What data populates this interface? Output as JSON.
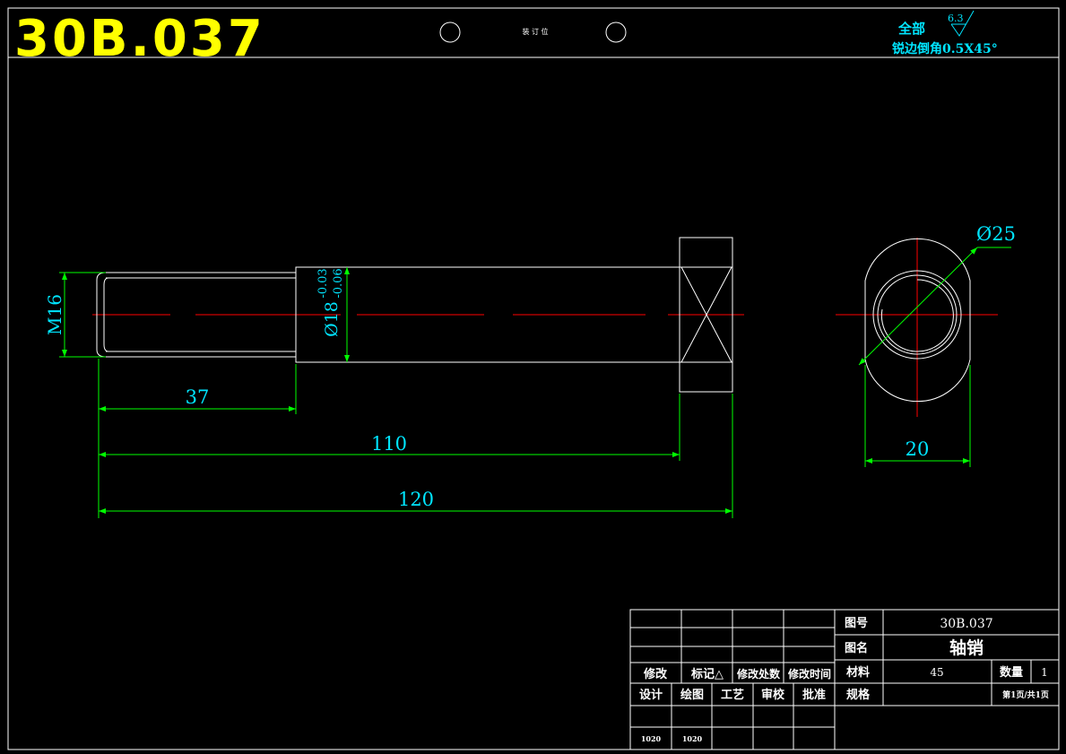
{
  "header": {
    "drawing_code": "30B.037",
    "binding_label": "装 订 位"
  },
  "surface_note": {
    "all_label": "全部",
    "roughness_value": "6.3",
    "chamfer_note": "锐边倒角0.5X45°"
  },
  "dimensions": {
    "thread": "M16",
    "diameter_main": "Ø18",
    "tol_upper": "-0.03",
    "tol_lower": "-0.06",
    "len_thread": "37",
    "len_shank": "110",
    "len_total": "120",
    "diameter_head": "Ø25",
    "width_flats": "20"
  },
  "title_block": {
    "drawing_no_label": "图号",
    "drawing_no_value": "30B.037",
    "name_label": "图名",
    "name_value": "轴销",
    "material_label": "材料",
    "material_value": "45",
    "qty_label": "数量",
    "qty_value": "1",
    "spec_label": "规格",
    "page_info": "第1页/共1页",
    "rev_headers": [
      "修改",
      "标记△",
      "修改处数",
      "修改时间"
    ],
    "sign_headers": [
      "设计",
      "绘图",
      "工艺",
      "审校",
      "批准"
    ],
    "sign_dates": [
      "1020",
      "1020"
    ]
  },
  "colors": {
    "outline": "#ffffff",
    "dimension": "#00ff00",
    "dimension_text": "#00e5ff",
    "centerline": "#ff0000",
    "title_code": "#ffff00"
  }
}
